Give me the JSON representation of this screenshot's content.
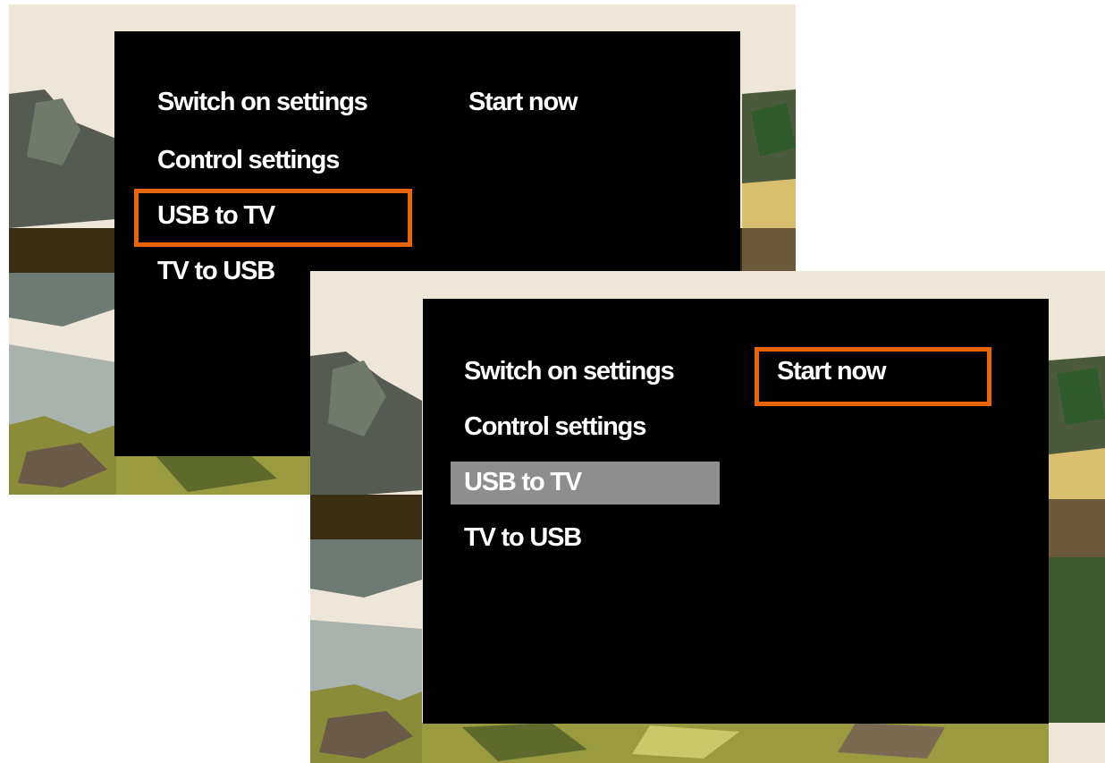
{
  "colors": {
    "panel": "#000000",
    "text": "#ffffff",
    "focus": "#e8650a",
    "selected_row": "#8e8e8e",
    "sky": "#efe6da"
  },
  "screens": [
    {
      "menu": {
        "items": [
          {
            "label": "Switch on settings"
          },
          {
            "label": "Control settings"
          },
          {
            "label": "USB to TV"
          },
          {
            "label": "TV to USB"
          }
        ],
        "submenu": {
          "label": "Start now"
        }
      },
      "focused_item": "USB to TV"
    },
    {
      "menu": {
        "items": [
          {
            "label": "Switch on settings"
          },
          {
            "label": "Control settings"
          },
          {
            "label": "USB to TV",
            "selected": true
          },
          {
            "label": "TV to USB"
          }
        ],
        "submenu": {
          "label": "Start now"
        }
      },
      "focused_item": "Start now"
    }
  ]
}
